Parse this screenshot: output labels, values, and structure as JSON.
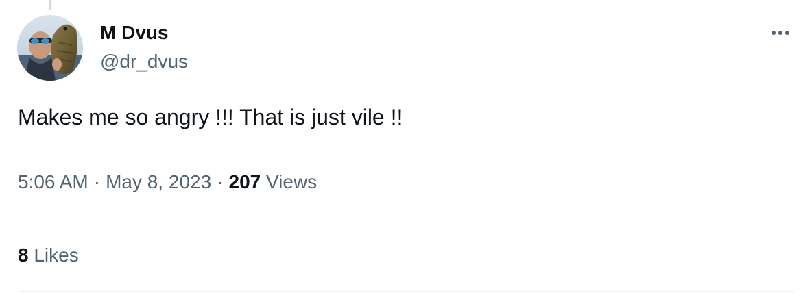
{
  "author": {
    "display_name": "M Dvus",
    "handle": "@dr_dvus",
    "avatar_icon": "avatar-photo"
  },
  "tweet": {
    "text": "Makes me so angry !!! That is just vile !!"
  },
  "meta": {
    "time": "5:06 AM",
    "separator": "·",
    "date": "May 8, 2023",
    "views_count": "207",
    "views_label": "Views"
  },
  "stats": {
    "likes_count": "8",
    "likes_label": "Likes"
  },
  "icons": {
    "more": "more-options-icon"
  },
  "colors": {
    "text_primary": "#0f1419",
    "text_secondary": "#536471",
    "divider": "#eff3f4",
    "thread_line": "#cfd9de"
  }
}
